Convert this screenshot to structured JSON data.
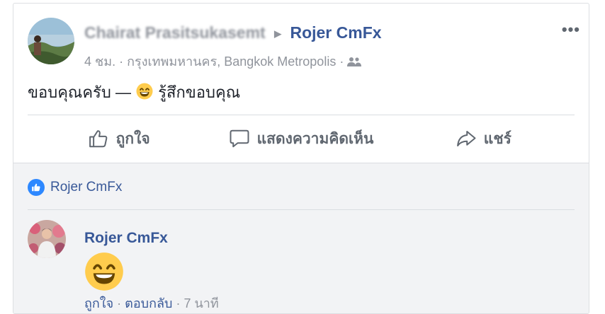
{
  "post": {
    "author_blurred": "Chairat Prasitsukasemt",
    "target_page": "Rojer CmFx",
    "time": "4 ชม.",
    "location": "กรุงเทพมหานคร, Bangkok Metropolis",
    "separator": "·",
    "text_before_emoji": "ขอบคุณครับ —",
    "feeling": "รู้สึกขอบคุณ",
    "more_label": "•••"
  },
  "actions": {
    "like": "ถูกใจ",
    "comment": "แสดงความคิดเห็น",
    "share": "แชร์"
  },
  "likes": {
    "names": "Rojer CmFx"
  },
  "comment": {
    "author": "Rojer CmFx",
    "like": "ถูกใจ",
    "reply": "ตอบกลับ",
    "time": "7 นาที",
    "separator": "·"
  },
  "colors": {
    "link_blue": "#385898",
    "like_badge": "#2d88ff",
    "emoji_yellow": "#ffcc4d",
    "comment_bg": "#f2f3f5"
  }
}
